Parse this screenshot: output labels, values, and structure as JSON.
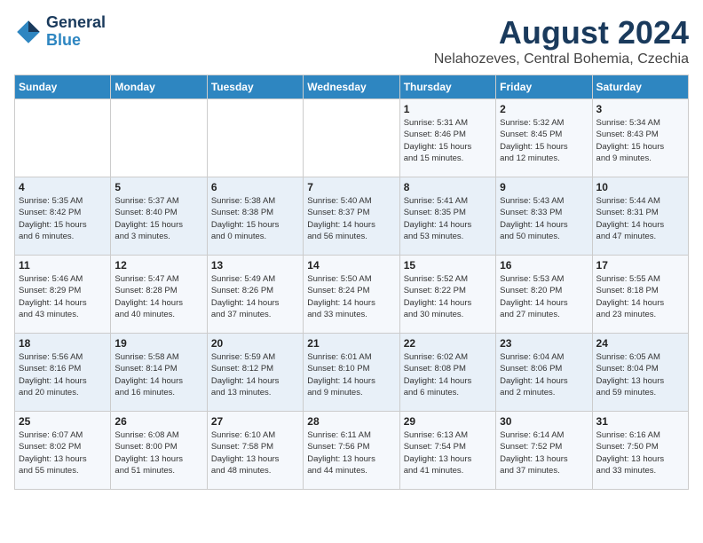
{
  "logo": {
    "line1": "General",
    "line2": "Blue"
  },
  "title": "August 2024",
  "subtitle": "Nelahozeves, Central Bohemia, Czechia",
  "days_of_week": [
    "Sunday",
    "Monday",
    "Tuesday",
    "Wednesday",
    "Thursday",
    "Friday",
    "Saturday"
  ],
  "weeks": [
    [
      {
        "day": "",
        "info": ""
      },
      {
        "day": "",
        "info": ""
      },
      {
        "day": "",
        "info": ""
      },
      {
        "day": "",
        "info": ""
      },
      {
        "day": "1",
        "info": "Sunrise: 5:31 AM\nSunset: 8:46 PM\nDaylight: 15 hours\nand 15 minutes."
      },
      {
        "day": "2",
        "info": "Sunrise: 5:32 AM\nSunset: 8:45 PM\nDaylight: 15 hours\nand 12 minutes."
      },
      {
        "day": "3",
        "info": "Sunrise: 5:34 AM\nSunset: 8:43 PM\nDaylight: 15 hours\nand 9 minutes."
      }
    ],
    [
      {
        "day": "4",
        "info": "Sunrise: 5:35 AM\nSunset: 8:42 PM\nDaylight: 15 hours\nand 6 minutes."
      },
      {
        "day": "5",
        "info": "Sunrise: 5:37 AM\nSunset: 8:40 PM\nDaylight: 15 hours\nand 3 minutes."
      },
      {
        "day": "6",
        "info": "Sunrise: 5:38 AM\nSunset: 8:38 PM\nDaylight: 15 hours\nand 0 minutes."
      },
      {
        "day": "7",
        "info": "Sunrise: 5:40 AM\nSunset: 8:37 PM\nDaylight: 14 hours\nand 56 minutes."
      },
      {
        "day": "8",
        "info": "Sunrise: 5:41 AM\nSunset: 8:35 PM\nDaylight: 14 hours\nand 53 minutes."
      },
      {
        "day": "9",
        "info": "Sunrise: 5:43 AM\nSunset: 8:33 PM\nDaylight: 14 hours\nand 50 minutes."
      },
      {
        "day": "10",
        "info": "Sunrise: 5:44 AM\nSunset: 8:31 PM\nDaylight: 14 hours\nand 47 minutes."
      }
    ],
    [
      {
        "day": "11",
        "info": "Sunrise: 5:46 AM\nSunset: 8:29 PM\nDaylight: 14 hours\nand 43 minutes."
      },
      {
        "day": "12",
        "info": "Sunrise: 5:47 AM\nSunset: 8:28 PM\nDaylight: 14 hours\nand 40 minutes."
      },
      {
        "day": "13",
        "info": "Sunrise: 5:49 AM\nSunset: 8:26 PM\nDaylight: 14 hours\nand 37 minutes."
      },
      {
        "day": "14",
        "info": "Sunrise: 5:50 AM\nSunset: 8:24 PM\nDaylight: 14 hours\nand 33 minutes."
      },
      {
        "day": "15",
        "info": "Sunrise: 5:52 AM\nSunset: 8:22 PM\nDaylight: 14 hours\nand 30 minutes."
      },
      {
        "day": "16",
        "info": "Sunrise: 5:53 AM\nSunset: 8:20 PM\nDaylight: 14 hours\nand 27 minutes."
      },
      {
        "day": "17",
        "info": "Sunrise: 5:55 AM\nSunset: 8:18 PM\nDaylight: 14 hours\nand 23 minutes."
      }
    ],
    [
      {
        "day": "18",
        "info": "Sunrise: 5:56 AM\nSunset: 8:16 PM\nDaylight: 14 hours\nand 20 minutes."
      },
      {
        "day": "19",
        "info": "Sunrise: 5:58 AM\nSunset: 8:14 PM\nDaylight: 14 hours\nand 16 minutes."
      },
      {
        "day": "20",
        "info": "Sunrise: 5:59 AM\nSunset: 8:12 PM\nDaylight: 14 hours\nand 13 minutes."
      },
      {
        "day": "21",
        "info": "Sunrise: 6:01 AM\nSunset: 8:10 PM\nDaylight: 14 hours\nand 9 minutes."
      },
      {
        "day": "22",
        "info": "Sunrise: 6:02 AM\nSunset: 8:08 PM\nDaylight: 14 hours\nand 6 minutes."
      },
      {
        "day": "23",
        "info": "Sunrise: 6:04 AM\nSunset: 8:06 PM\nDaylight: 14 hours\nand 2 minutes."
      },
      {
        "day": "24",
        "info": "Sunrise: 6:05 AM\nSunset: 8:04 PM\nDaylight: 13 hours\nand 59 minutes."
      }
    ],
    [
      {
        "day": "25",
        "info": "Sunrise: 6:07 AM\nSunset: 8:02 PM\nDaylight: 13 hours\nand 55 minutes."
      },
      {
        "day": "26",
        "info": "Sunrise: 6:08 AM\nSunset: 8:00 PM\nDaylight: 13 hours\nand 51 minutes."
      },
      {
        "day": "27",
        "info": "Sunrise: 6:10 AM\nSunset: 7:58 PM\nDaylight: 13 hours\nand 48 minutes."
      },
      {
        "day": "28",
        "info": "Sunrise: 6:11 AM\nSunset: 7:56 PM\nDaylight: 13 hours\nand 44 minutes."
      },
      {
        "day": "29",
        "info": "Sunrise: 6:13 AM\nSunset: 7:54 PM\nDaylight: 13 hours\nand 41 minutes."
      },
      {
        "day": "30",
        "info": "Sunrise: 6:14 AM\nSunset: 7:52 PM\nDaylight: 13 hours\nand 37 minutes."
      },
      {
        "day": "31",
        "info": "Sunrise: 6:16 AM\nSunset: 7:50 PM\nDaylight: 13 hours\nand 33 minutes."
      }
    ]
  ]
}
